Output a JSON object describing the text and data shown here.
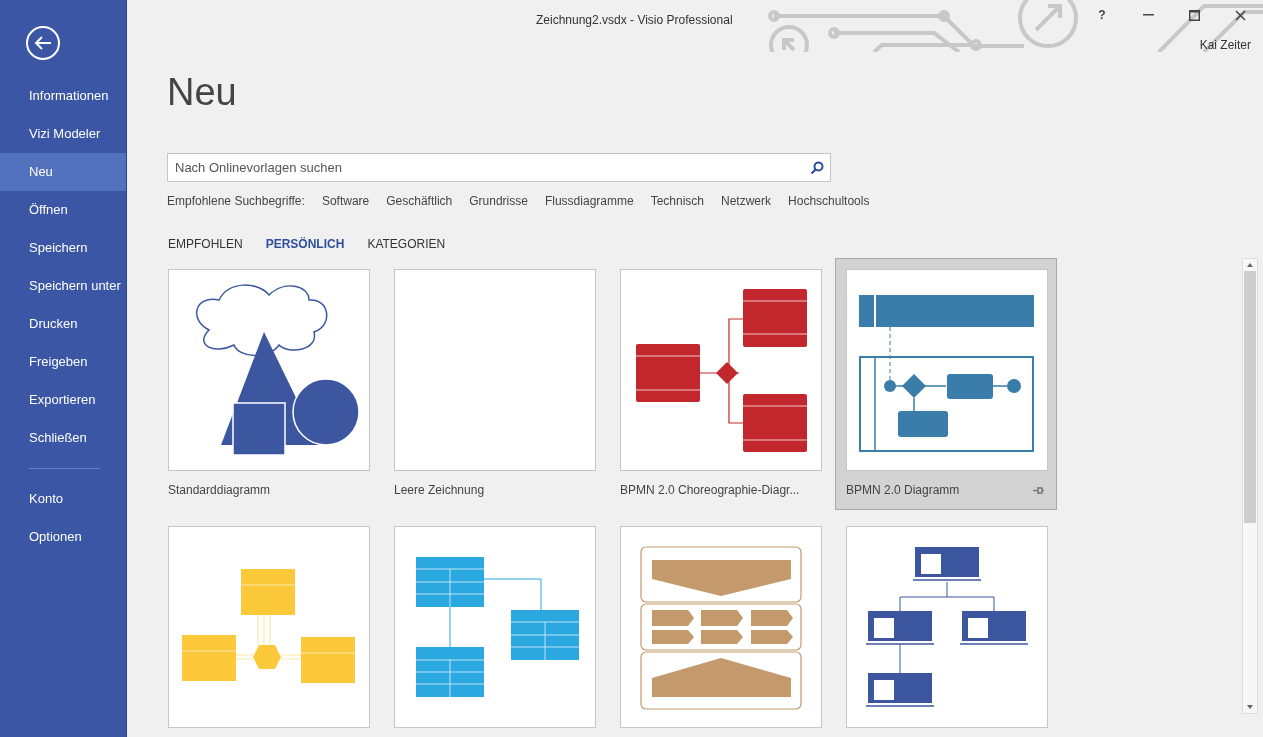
{
  "window": {
    "title": "Zeichnung2.vsdx - Visio Professional",
    "user": "Kai Zeiter",
    "help": "?"
  },
  "sidebar": {
    "items": [
      {
        "label": "Informationen",
        "selected": false
      },
      {
        "label": "Vizi Modeler",
        "selected": false
      },
      {
        "label": "Neu",
        "selected": true
      },
      {
        "label": "Öffnen",
        "selected": false
      },
      {
        "label": "Speichern",
        "selected": false
      },
      {
        "label": "Speichern unter",
        "selected": false
      },
      {
        "label": "Drucken",
        "selected": false
      },
      {
        "label": "Freigeben",
        "selected": false
      },
      {
        "label": "Exportieren",
        "selected": false
      },
      {
        "label": "Schließen",
        "selected": false
      }
    ],
    "bottom_items": [
      {
        "label": "Konto",
        "selected": false
      },
      {
        "label": "Optionen",
        "selected": false
      }
    ]
  },
  "page_title": "Neu",
  "search": {
    "placeholder": "Nach Onlinevorlagen suchen"
  },
  "suggestions": {
    "label": "Empfohlene Suchbegriffe:",
    "terms": [
      "Software",
      "Geschäftlich",
      "Grundrisse",
      "Flussdiagramme",
      "Technisch",
      "Netzwerk",
      "Hochschultools"
    ]
  },
  "tabs": [
    {
      "label": "EMPFOHLEN",
      "selected": false
    },
    {
      "label": "PERSÖNLICH",
      "selected": true
    },
    {
      "label": "KATEGORIEN",
      "selected": false
    }
  ],
  "templates": [
    {
      "kind": "basic",
      "label": "Standarddiagramm",
      "selected": false
    },
    {
      "kind": "blank",
      "label": "Leere Zeichnung",
      "selected": false
    },
    {
      "kind": "choreography",
      "label": "BPMN 2.0 Choreographie-Diagr...",
      "selected": false
    },
    {
      "kind": "bpmn",
      "label": "BPMN 2.0 Diagramm",
      "selected": true
    },
    {
      "kind": "uml",
      "selected": false
    },
    {
      "kind": "database",
      "selected": false
    },
    {
      "kind": "process",
      "selected": false
    },
    {
      "kind": "orgchart",
      "selected": false
    }
  ]
}
